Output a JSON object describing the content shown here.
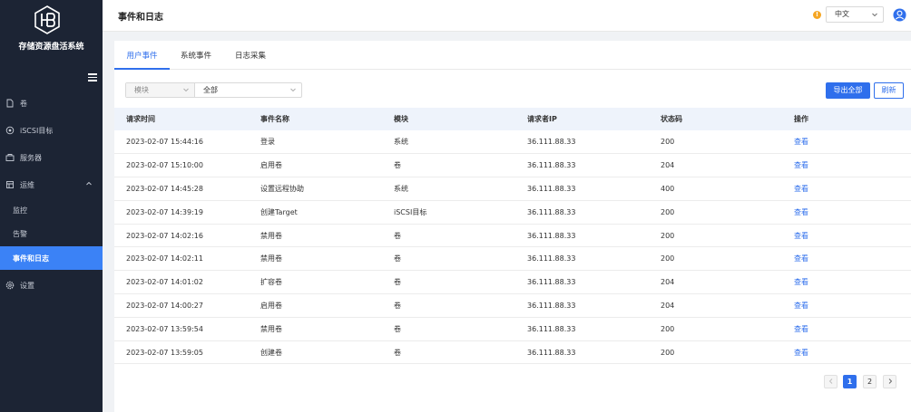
{
  "app": {
    "name": "存储资源盘活系统"
  },
  "sidebar": {
    "items": [
      {
        "label": "卷",
        "icon": "file-icon"
      },
      {
        "label": "iSCSI目标",
        "icon": "target-icon"
      },
      {
        "label": "服务器",
        "icon": "server-icon"
      },
      {
        "label": "运维",
        "icon": "maintenance-icon"
      },
      {
        "label": "监控"
      },
      {
        "label": "告警"
      },
      {
        "label": "事件和日志"
      },
      {
        "label": "设置",
        "icon": "gear-icon"
      }
    ]
  },
  "header": {
    "title": "事件和日志",
    "language": "中文"
  },
  "tabs": [
    {
      "label": "用户事件"
    },
    {
      "label": "系统事件"
    },
    {
      "label": "日志采集"
    }
  ],
  "filter": {
    "field": "模块",
    "value": "全部"
  },
  "toolbar": {
    "export_label": "导出全部",
    "refresh_label": "刷新"
  },
  "table": {
    "headers": [
      "请求时间",
      "事件名称",
      "模块",
      "请求者IP",
      "状态码",
      "操作"
    ],
    "rows": [
      [
        "2023-02-07 15:44:16",
        "登录",
        "系统",
        "36.111.88.33",
        "200",
        "查看"
      ],
      [
        "2023-02-07 15:10:00",
        "启用卷",
        "卷",
        "36.111.88.33",
        "204",
        "查看"
      ],
      [
        "2023-02-07 14:45:28",
        "设置远程协助",
        "系统",
        "36.111.88.33",
        "400",
        "查看"
      ],
      [
        "2023-02-07 14:39:19",
        "创建Target",
        "iSCSI目标",
        "36.111.88.33",
        "200",
        "查看"
      ],
      [
        "2023-02-07 14:02:16",
        "禁用卷",
        "卷",
        "36.111.88.33",
        "200",
        "查看"
      ],
      [
        "2023-02-07 14:02:11",
        "禁用卷",
        "卷",
        "36.111.88.33",
        "200",
        "查看"
      ],
      [
        "2023-02-07 14:01:02",
        "扩容卷",
        "卷",
        "36.111.88.33",
        "204",
        "查看"
      ],
      [
        "2023-02-07 14:00:27",
        "启用卷",
        "卷",
        "36.111.88.33",
        "204",
        "查看"
      ],
      [
        "2023-02-07 13:59:54",
        "禁用卷",
        "卷",
        "36.111.88.33",
        "200",
        "查看"
      ],
      [
        "2023-02-07 13:59:05",
        "创建卷",
        "卷",
        "36.111.88.33",
        "200",
        "查看"
      ]
    ]
  },
  "pagination": {
    "pages": [
      "1",
      "2"
    ],
    "current": "1"
  },
  "colors": {
    "accent": "#2f6fec",
    "sidebar_bg": "#1c2434",
    "sidebar_active": "#3b82f6",
    "warning": "#f5a623"
  }
}
